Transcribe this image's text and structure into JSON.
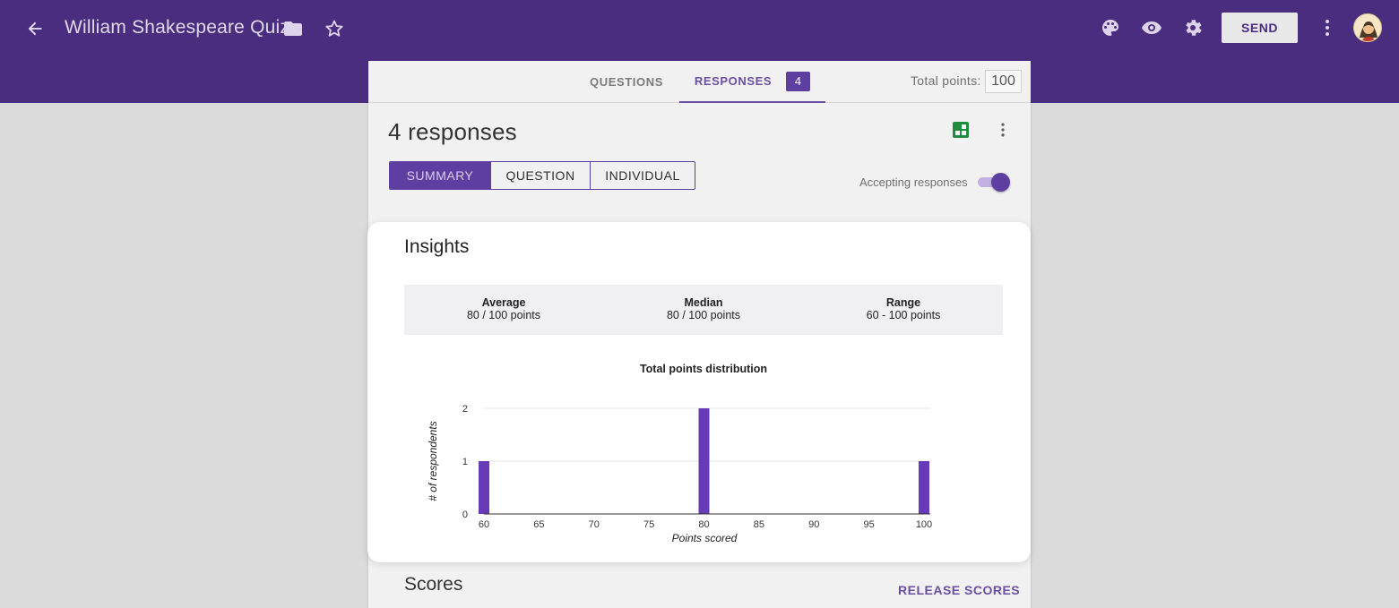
{
  "header": {
    "title": "William Shakespeare Quiz",
    "send_label": "SEND",
    "icons": [
      "back-arrow-icon",
      "folder-icon",
      "star-icon",
      "palette-icon",
      "eye-icon",
      "gear-icon",
      "more-vert-icon",
      "avatar"
    ],
    "bar_color": "#4a2d7e"
  },
  "tabs": {
    "questions": "QUESTIONS",
    "responses": "RESPONSES",
    "responses_count": "4",
    "total_points_label": "Total points:",
    "total_points_value": "100"
  },
  "responses": {
    "heading": "4 responses",
    "views": [
      "SUMMARY",
      "QUESTION",
      "INDIVIDUAL"
    ],
    "selected_view": "SUMMARY",
    "accepting_label": "Accepting responses",
    "accepting": true
  },
  "insights": {
    "title": "Insights",
    "stats": [
      {
        "label": "Average",
        "value": "80 / 100 points"
      },
      {
        "label": "Median",
        "value": "80 / 100 points"
      },
      {
        "label": "Range",
        "value": "60 - 100 points"
      }
    ]
  },
  "scores": {
    "title": "Scores",
    "release_label": "RELEASE SCORES"
  },
  "colors": {
    "accent": "#5e3fa1",
    "bar": "#673ab7"
  },
  "chart_data": {
    "type": "bar",
    "title": "Total points distribution",
    "xlabel": "Points scored",
    "ylabel": "# of respondents",
    "x": [
      60,
      80,
      100
    ],
    "values": [
      1,
      2,
      1
    ],
    "xticks": [
      "60",
      "65",
      "70",
      "75",
      "80",
      "85",
      "90",
      "95",
      "100"
    ],
    "yticks": [
      "0",
      "1",
      "2"
    ],
    "xlim": [
      60,
      100
    ],
    "ylim": [
      0,
      2
    ],
    "grid": true,
    "legend": "none"
  }
}
